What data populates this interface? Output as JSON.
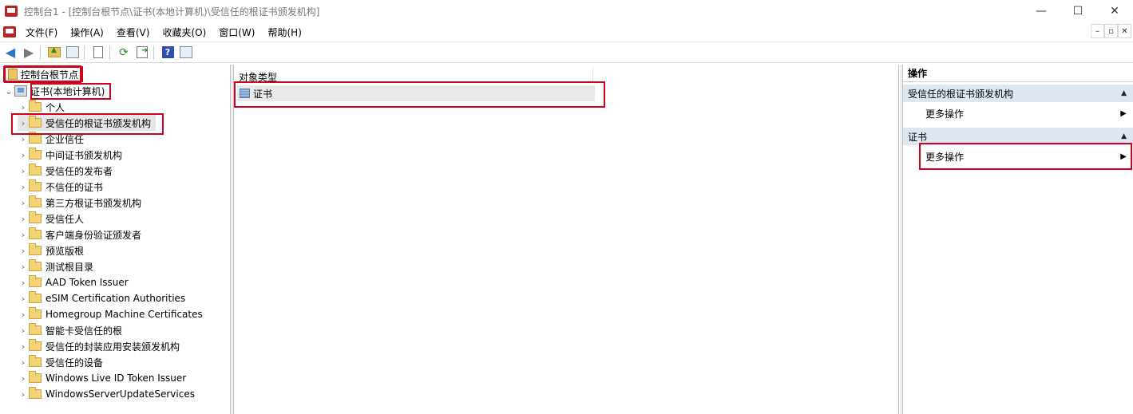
{
  "window": {
    "title": "控制台1 - [控制台根节点\\证书(本地计算机)\\受信任的根证书颁发机构]",
    "minimize": "—",
    "maximize": "☐",
    "close": "✕"
  },
  "menu": {
    "items": [
      "文件(F)",
      "操作(A)",
      "查看(V)",
      "收藏夹(O)",
      "窗口(W)",
      "帮助(H)"
    ],
    "mdi": [
      "–",
      "▫",
      "✕"
    ]
  },
  "toolbar": {
    "icons": [
      "back-icon",
      "forward-icon",
      "up-folder-icon",
      "show-hide-tree-icon",
      "properties-icon",
      "refresh-icon",
      "export-list-icon",
      "help-icon",
      "show-action-pane-icon"
    ]
  },
  "tree": {
    "root": "控制台根节点",
    "computer": "证书(本地计算机)",
    "stores": [
      "个人",
      "受信任的根证书颁发机构",
      "企业信任",
      "中间证书颁发机构",
      "受信任的发布者",
      "不信任的证书",
      "第三方根证书颁发机构",
      "受信任人",
      "客户端身份验证颁发者",
      "预览版根",
      "测试根目录",
      "AAD Token Issuer",
      "eSIM Certification Authorities",
      "Homegroup Machine Certificates",
      "智能卡受信任的根",
      "受信任的封装应用安装颁发机构",
      "受信任的设备",
      "Windows Live ID Token Issuer",
      "WindowsServerUpdateServices"
    ],
    "selected_index": 1
  },
  "list": {
    "column": "对象类型",
    "rows": [
      "证书"
    ]
  },
  "actions": {
    "title": "操作",
    "sections": [
      {
        "label": "受信任的根证书颁发机构",
        "item": "更多操作"
      },
      {
        "label": "证书",
        "item": "更多操作"
      }
    ]
  },
  "colors": {
    "highlight_border": "#d0021b",
    "section_bg": "#dde6f1",
    "folder": "#f1d37a"
  }
}
